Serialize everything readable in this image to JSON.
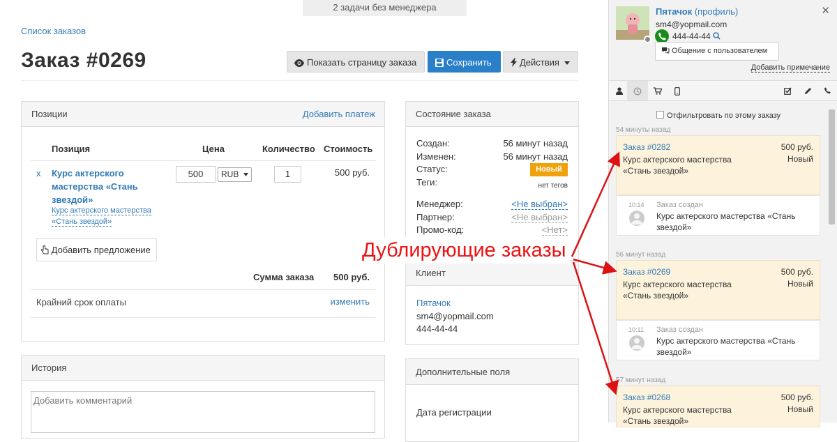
{
  "notice": "2 задачи без менеджера",
  "breadcrumb": "Список заказов",
  "order_title": "Заказ #0269",
  "buttons": {
    "show_page": "Показать страницу заказа",
    "save": "Сохранить",
    "actions": "Действия"
  },
  "positions": {
    "title": "Позиции",
    "add_payment": "Добавить платеж",
    "columns": [
      "Позиция",
      "Цена",
      "Количество",
      "Стоимость"
    ],
    "item": {
      "remove": "x",
      "name": "Курс актерского мастерства «Стань звездой»",
      "variant": "Курс актерского мастерства «Стань звездой»",
      "price": "500",
      "currency": "RUB",
      "quantity": "1",
      "cost": "500 руб."
    },
    "add_offer": "Добавить предложение",
    "total_label": "Сумма заказа",
    "total_value": "500 руб.",
    "deadline_label": "Крайний срок оплаты",
    "deadline_action": "изменить"
  },
  "state": {
    "title": "Состояние заказа",
    "created_label": "Создан:",
    "created_value": "56 минут назад",
    "changed_label": "Изменен:",
    "changed_value": "56 минут назад",
    "status_label": "Статус:",
    "status_value": "Новый",
    "status_color": "#f0a20c",
    "tags_label": "Теги:",
    "tags_value": "нет тегов",
    "manager_label": "Менеджер:",
    "manager_value": "<Не выбран>",
    "partner_label": "Партнер:",
    "partner_value": "<Не выбран>",
    "promo_label": "Промо-код:",
    "promo_value": "<Нет>"
  },
  "client": {
    "title": "Клиент",
    "name": "Пятачок",
    "email": "sm4@yopmail.com",
    "phone": "444-44-44"
  },
  "history": {
    "title": "История",
    "comment_placeholder": "Добавить комментарий"
  },
  "extra": {
    "title": "Дополнительные поля",
    "reg_date_label": "Дата регистрации"
  },
  "annotation": "Дублирующие заказы",
  "sidebar": {
    "name": "Пятачок",
    "profile_link": "(профиль)",
    "email": "sm4@yopmail.com",
    "phone": "444-44-44",
    "chat_button": "Общение с пользователем",
    "add_note": "Добавить примечание",
    "filter_label": "Отфильтровать по этому заказу",
    "groups": [
      {
        "time": "54 минуты назад",
        "order": {
          "id": "Заказ #0282",
          "sum": "500 руб.",
          "status": "Новый",
          "name": "Курс актерского мастерства «Стань звездой»"
        },
        "event": {
          "time": "10:14",
          "type": "Заказ создан",
          "text": "Курс актерского мастерства «Стань звездой»"
        }
      },
      {
        "time": "56 минут назад",
        "order": {
          "id": "Заказ #0269",
          "sum": "500 руб.",
          "status": "Новый",
          "name": "Курс актерского мастерства «Стань звездой»"
        },
        "event": {
          "time": "10:11",
          "type": "Заказ создан",
          "text": "Курс актерского мастерства «Стань звездой»"
        }
      },
      {
        "time": "57 минут назад",
        "order": {
          "id": "Заказ #0268",
          "sum": "500 руб.",
          "status": "Новый",
          "name": "Курс актерского мастерства «Стань звездой»"
        }
      }
    ]
  },
  "colors": {
    "accent": "#337ab7",
    "primary_button": "#2a7fc9",
    "annotation_red": "#ee1111",
    "order_card_bg": "#fdf3dd"
  }
}
